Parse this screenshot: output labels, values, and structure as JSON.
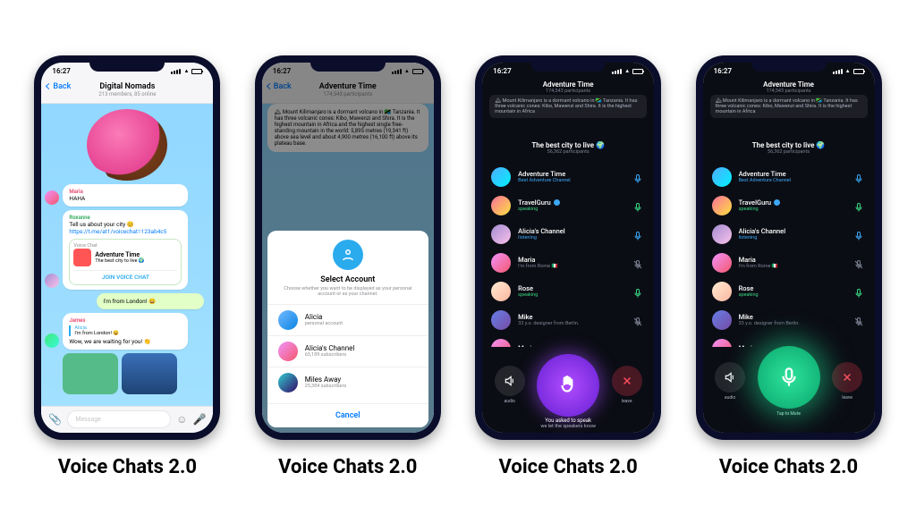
{
  "caption": "Voice Chats 2.0",
  "statusTime": "16:27",
  "screen1": {
    "back": "Back",
    "title": "Digital Nomads",
    "subtitle": "213 members, 85 online",
    "msgs": {
      "m1_sender": "Maria",
      "m1_text": "HAHA",
      "m2_sender": "Roxanne",
      "m2_line1": "Tell us about your city 😊",
      "m2_link": "https://t.me/at1/voicechat=123ab4c5",
      "vc_label": "Voice Chat",
      "vc_title": "Adventure Time",
      "vc_sub": "The best city to live 🌍",
      "vc_join": "JOIN VOICE CHAT",
      "m3_text": "I'm from London! 😄",
      "m4_sender": "James",
      "m4_reply_name": "Alicia",
      "m4_reply_text": "I'm from London! 😄",
      "m4_text": "Wow, we are waiting for you! 👏"
    },
    "inputPlaceholder": "Message"
  },
  "screen2": {
    "back": "Back",
    "title": "Adventure Time",
    "participants": "174,543 participants",
    "info": "🏔 Mount Kilimanjaro is a dormant volcano in 🇹🇿 Tanzania. It has three volcanic cones: Kibo, Mawenzi and Shira. It is the highest mountain in Africa and the highest single free-standing mountain in the world: 5,895 metres (19,341 ft) above sea level and about 4,900 metres (16,100 ft) above its plateau base.",
    "sheet": {
      "title": "Select Account",
      "sub": "Choose whether you want to be displayed as your personal account or as your channel.",
      "opt1_name": "Alicia",
      "opt1_sub": "personal account",
      "opt2_name": "Alicia's Channel",
      "opt2_sub": "65,189 subscribers",
      "opt3_name": "Miles Away",
      "opt3_sub": "25,384 subscribers",
      "cancel": "Cancel"
    }
  },
  "screen3": {
    "headerTitle": "Adventure Time",
    "headerSub": "174,543 participants",
    "info": "🏔 Mount Kilimanjaro is a dormant volcano in 🇹🇿 Tanzania. It has three volcanic cones: Kibo, Mawenzi and Shira. It is the highest mountain in Africa",
    "roomTitle": "The best city to live 🌍",
    "roomSub": "56,362 participants",
    "items": [
      {
        "name": "Adventure Time",
        "sub": "Best Adventure Channel",
        "subClass": "blue",
        "av": "b",
        "verified": false,
        "state": "mic-b"
      },
      {
        "name": "TravelGuru",
        "sub": "speaking",
        "subClass": "green",
        "av": "c",
        "verified": true,
        "state": "mic-g"
      },
      {
        "name": "Alicia's Channel",
        "sub": "listening",
        "subClass": "blue",
        "av": "d",
        "verified": false,
        "state": "mic-b"
      },
      {
        "name": "Maria",
        "sub": "I'm from Rome 🇮🇹",
        "subClass": "grey",
        "av": "a",
        "verified": false,
        "state": "mic-x"
      },
      {
        "name": "Rose",
        "sub": "speaking",
        "subClass": "green",
        "av": "e",
        "verified": false,
        "state": "mic-g"
      },
      {
        "name": "Mike",
        "sub": "33 y.o. designer from Berlin.",
        "subClass": "grey",
        "av": "f",
        "verified": false,
        "state": "mic-x"
      },
      {
        "name": "Marie",
        "sub": "",
        "subClass": "grey",
        "av": "a",
        "verified": false,
        "state": ""
      }
    ],
    "audioLabel": "audio",
    "leaveLabel": "leave",
    "bigLabel1": "You asked to speak",
    "bigLabel2": "we let the speakers know"
  },
  "screen4": {
    "items": [
      {
        "name": "Adventure Time",
        "sub": "Best Adventure Channel",
        "subClass": "blue",
        "av": "b",
        "verified": false,
        "state": "mic-b"
      },
      {
        "name": "TravelGuru",
        "sub": "speaking",
        "subClass": "green",
        "av": "c",
        "verified": true,
        "state": "mic-g"
      },
      {
        "name": "Alicia's Channel",
        "sub": "listening",
        "subClass": "blue",
        "av": "d",
        "verified": false,
        "state": "mic-b"
      },
      {
        "name": "Maria",
        "sub": "I'm from Rome 🇮🇹",
        "subClass": "grey",
        "av": "a",
        "verified": false,
        "state": "mic-x"
      },
      {
        "name": "Rose",
        "sub": "speaking",
        "subClass": "green",
        "av": "e",
        "verified": false,
        "state": "mic-g"
      },
      {
        "name": "Mike",
        "sub": "33 y.o. designer from Berlin.",
        "subClass": "grey",
        "av": "f",
        "verified": false,
        "state": "mic-x"
      },
      {
        "name": "Marie",
        "sub": "",
        "subClass": "grey",
        "av": "a",
        "verified": false,
        "state": ""
      }
    ],
    "bigLabel": "Tap to Mute"
  }
}
